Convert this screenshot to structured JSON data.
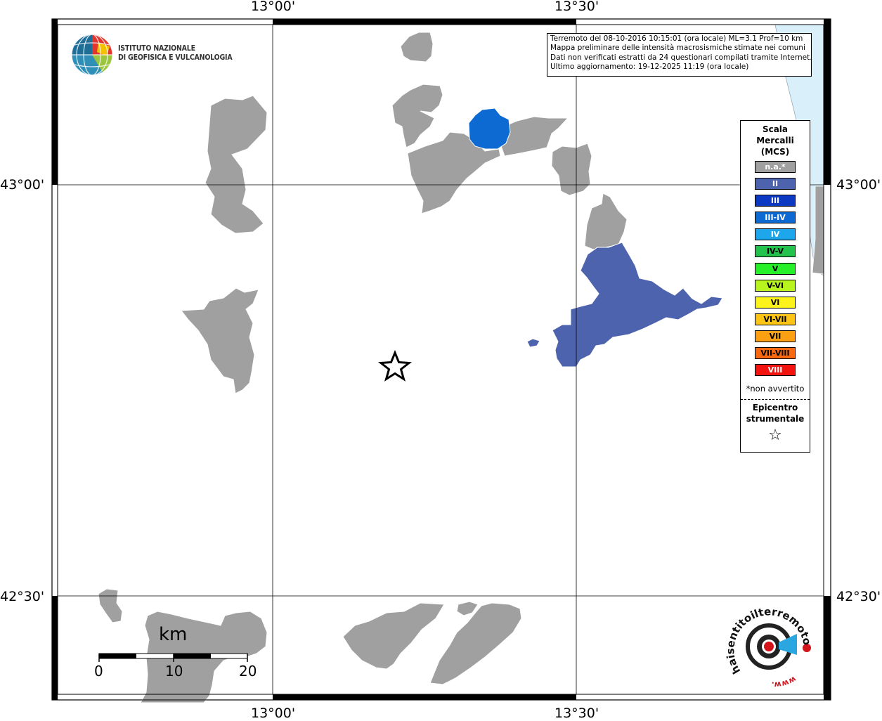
{
  "coords": {
    "top": [
      "13°00'",
      "13°30'"
    ],
    "bottom": [
      "13°00'",
      "13°30'"
    ],
    "left": [
      "43°00'",
      "42°30'"
    ],
    "right": [
      "43°00'",
      "42°30'"
    ]
  },
  "institute": {
    "line1": "ISTITUTO NAZIONALE",
    "line2": "DI GEOFISICA E VULCANOLOGIA"
  },
  "info": {
    "line1": "Terremoto del 08-10-2016 10:15:01 (ora locale) ML=3.1 Prof=10 km",
    "line2": "Mappa preliminare delle intensità macrosismiche stimate nei comuni",
    "line3": "Dati non verificati estratti da 24 questionari compilati tramite Internet.",
    "line4": "Ultimo aggiornamento: 19-12-2025 11:19 (ora locale)"
  },
  "legend": {
    "title1": "Scala",
    "title2": "Mercalli",
    "title3": "(MCS)",
    "items": [
      {
        "label": "n.a.*",
        "color": "#a0a0a0",
        "text": "#ffffff"
      },
      {
        "label": "II",
        "color": "#4e63ad",
        "text": "#ffffff"
      },
      {
        "label": "III",
        "color": "#0b39c2",
        "text": "#ffffff"
      },
      {
        "label": "III-IV",
        "color": "#0e6ad3",
        "text": "#ffffff"
      },
      {
        "label": "IV",
        "color": "#1ea6ec",
        "text": "#ffffff"
      },
      {
        "label": "IV-V",
        "color": "#22c24c",
        "text": "#000000"
      },
      {
        "label": "V",
        "color": "#27ef28",
        "text": "#000000"
      },
      {
        "label": "V-VI",
        "color": "#b8f51f",
        "text": "#000000"
      },
      {
        "label": "VI",
        "color": "#fbf31a",
        "text": "#000000"
      },
      {
        "label": "VI-VII",
        "color": "#fcc515",
        "text": "#000000"
      },
      {
        "label": "VII",
        "color": "#fba012",
        "text": "#000000"
      },
      {
        "label": "VII-VIII",
        "color": "#f96a10",
        "text": "#000000"
      },
      {
        "label": "VIII",
        "color": "#f3130f",
        "text": "#ffffff"
      }
    ],
    "note": "*non avvertito",
    "epi1": "Epicentro",
    "epi2": "strumentale",
    "star": "☆"
  },
  "scale": {
    "title": "km",
    "labels": [
      "0",
      "10",
      "20"
    ]
  },
  "hst_logo": {
    "text": "haisentitoilterremoto.it",
    "prefix": "www."
  },
  "colors": {
    "gray": "#a0a0a0",
    "intensity_II": "#4e63ad",
    "intensity_III_IV": "#0e6ad3",
    "sea": "#d9f0fb"
  }
}
